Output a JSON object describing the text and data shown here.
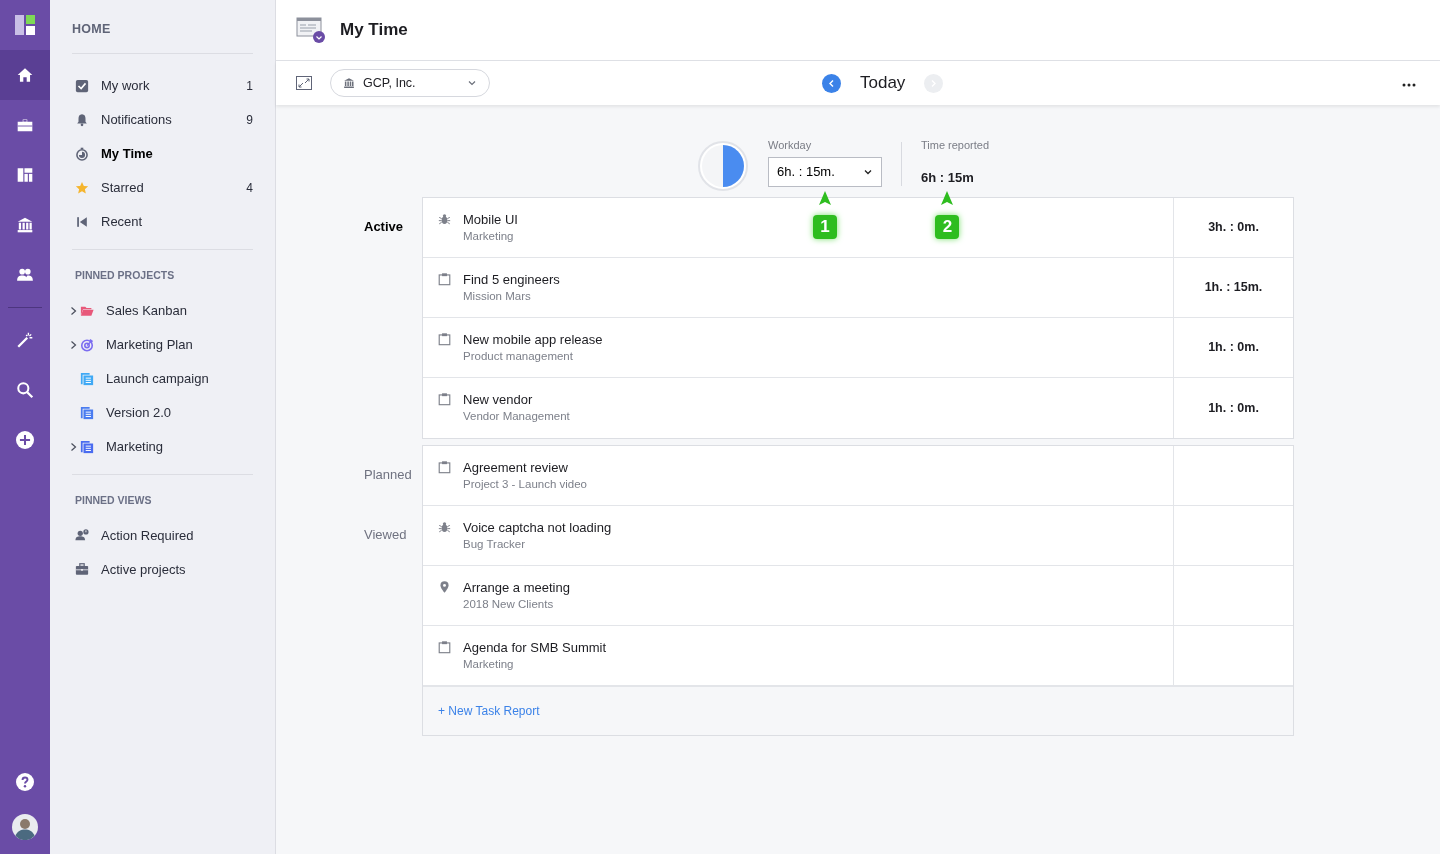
{
  "rail": {
    "items": [
      {
        "kind": "home",
        "selected": true
      },
      {
        "kind": "briefcase",
        "selected": false
      },
      {
        "kind": "board",
        "selected": false
      },
      {
        "kind": "bank",
        "selected": false
      },
      {
        "kind": "people",
        "selected": false
      },
      {
        "kind": "wand",
        "selected": false,
        "divider_before": true
      },
      {
        "kind": "search",
        "selected": false
      },
      {
        "kind": "plus",
        "selected": false
      }
    ]
  },
  "sidebar": {
    "title": "HOME",
    "items": [
      {
        "kind": "check",
        "label": "My work",
        "count": "1",
        "selected": false
      },
      {
        "kind": "bell",
        "label": "Notifications",
        "count": "9",
        "selected": false
      },
      {
        "kind": "timer",
        "label": "My Time",
        "selected": true
      },
      {
        "kind": "star",
        "label": "Starred",
        "count": "4",
        "selected": false
      },
      {
        "kind": "recent",
        "label": "Recent",
        "selected": false
      }
    ],
    "pinned_projects": {
      "title": "PINNED PROJECTS",
      "items": [
        {
          "kind": "folder",
          "label": "Sales Kanban",
          "color": "#e8587a",
          "has_children": true
        },
        {
          "kind": "target",
          "label": "Marketing Plan",
          "color": "#7b6cf0",
          "has_children": true
        },
        {
          "kind": "list",
          "label": "Launch campaign",
          "color": "#3fa9f5",
          "has_children": false
        },
        {
          "kind": "list",
          "label": "Version 2.0",
          "color": "#4a7cf0",
          "has_children": false
        },
        {
          "kind": "list",
          "label": "Marketing",
          "color": "#4a6cf0",
          "has_children": true
        }
      ]
    },
    "pinned_views": {
      "title": "PINNED VIEWS",
      "items": [
        {
          "kind": "person-alert",
          "label": "Action Required"
        },
        {
          "kind": "briefcase",
          "label": "Active projects"
        }
      ]
    }
  },
  "header": {
    "title": "My Time"
  },
  "toolbar": {
    "company": "GCP, Inc.",
    "date": "Today",
    "prev_enabled": true,
    "next_enabled": false
  },
  "summary": {
    "workday_label": "Workday",
    "workday_value": "6h. : 15m.",
    "level": 0.5,
    "reported_label": "Time reported",
    "reported_value": "6h : 15m"
  },
  "callouts": [
    {
      "label": "1"
    },
    {
      "label": "2"
    }
  ],
  "groups": [
    {
      "tasks": [
        {
          "kind": "bug",
          "title": "Mobile UI",
          "project": "Marketing",
          "time": "3h. : 0m.",
          "section": {
            "label": "Active",
            "current": true
          }
        },
        {
          "kind": "task",
          "title": "Find 5 engineers",
          "project": "Mission Mars",
          "time": "1h. : 15m."
        },
        {
          "kind": "task",
          "title": "New mobile app release",
          "project": "Product management",
          "time": "1h. : 0m."
        },
        {
          "kind": "task",
          "title": "New vendor",
          "project": "Vendor Management",
          "time": "1h. : 0m."
        }
      ]
    },
    {
      "tasks": [
        {
          "kind": "task",
          "title": "Agreement review",
          "project": "Project 3 - Launch video",
          "section": {
            "label": "Planned",
            "current": false
          }
        },
        {
          "kind": "bug",
          "title": "Voice captcha not loading",
          "project": "Bug Tracker",
          "section": {
            "label": "Viewed",
            "current": false
          }
        },
        {
          "kind": "pin",
          "title": "Arrange a meeting",
          "project": "2018 New Clients"
        },
        {
          "kind": "task",
          "title": "Agenda for SMB Summit",
          "project": "Marketing"
        }
      ],
      "new_link": "+ New Task Report"
    }
  ]
}
